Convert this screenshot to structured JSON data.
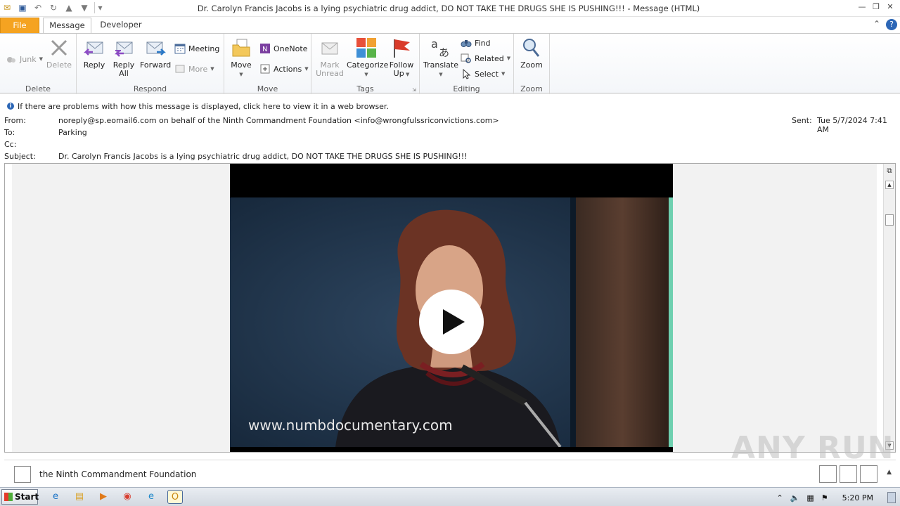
{
  "window": {
    "title": "Dr. Carolyn Francis Jacobs is a lying psychiatric drug addict, DO NOT TAKE THE DRUGS SHE IS PUSHING!!! -  Message (HTML)"
  },
  "tabs": {
    "file": "File",
    "message": "Message",
    "developer": "Developer"
  },
  "ribbon": {
    "delete_group": {
      "label": "Delete",
      "junk": "Junk",
      "delete": "Delete"
    },
    "respond_group": {
      "label": "Respond",
      "reply": "Reply",
      "reply_all_1": "Reply",
      "reply_all_2": "All",
      "forward": "Forward",
      "meeting": "Meeting",
      "more": "More"
    },
    "move_group": {
      "label": "Move",
      "move": "Move",
      "onenote": "OneNote",
      "actions": "Actions"
    },
    "tags_group": {
      "label": "Tags",
      "mark_unread_1": "Mark",
      "mark_unread_2": "Unread",
      "categorize": "Categorize",
      "follow_up_1": "Follow",
      "follow_up_2": "Up"
    },
    "editing_group": {
      "label": "Editing",
      "translate": "Translate",
      "find": "Find",
      "related": "Related",
      "select": "Select"
    },
    "zoom_group": {
      "label": "Zoom",
      "zoom": "Zoom"
    }
  },
  "infobar": {
    "text": "If there are problems with how this message is displayed, click here to view it in a web browser."
  },
  "header": {
    "from_label": "From:",
    "from_value": "noreply@sp.eomail6.com on behalf of the Ninth Commandment Foundation <info@wrongfulssriconvictions.com>",
    "to_label": "To:",
    "to_value": "Parking",
    "cc_label": "Cc:",
    "subject_label": "Subject:",
    "subject_value": "Dr. Carolyn Francis Jacobs is a lying psychiatric drug addict, DO NOT TAKE THE DRUGS SHE IS PUSHING!!!",
    "sent_label": "Sent:",
    "sent_value": "Tue 5/7/2024 7:41 AM"
  },
  "video": {
    "caption": "www.numbdocumentary.com"
  },
  "people_pane": {
    "name": "the Ninth Commandment Foundation"
  },
  "watermark": "ANY RUN",
  "taskbar": {
    "start": "Start",
    "clock": "5:20 PM"
  }
}
